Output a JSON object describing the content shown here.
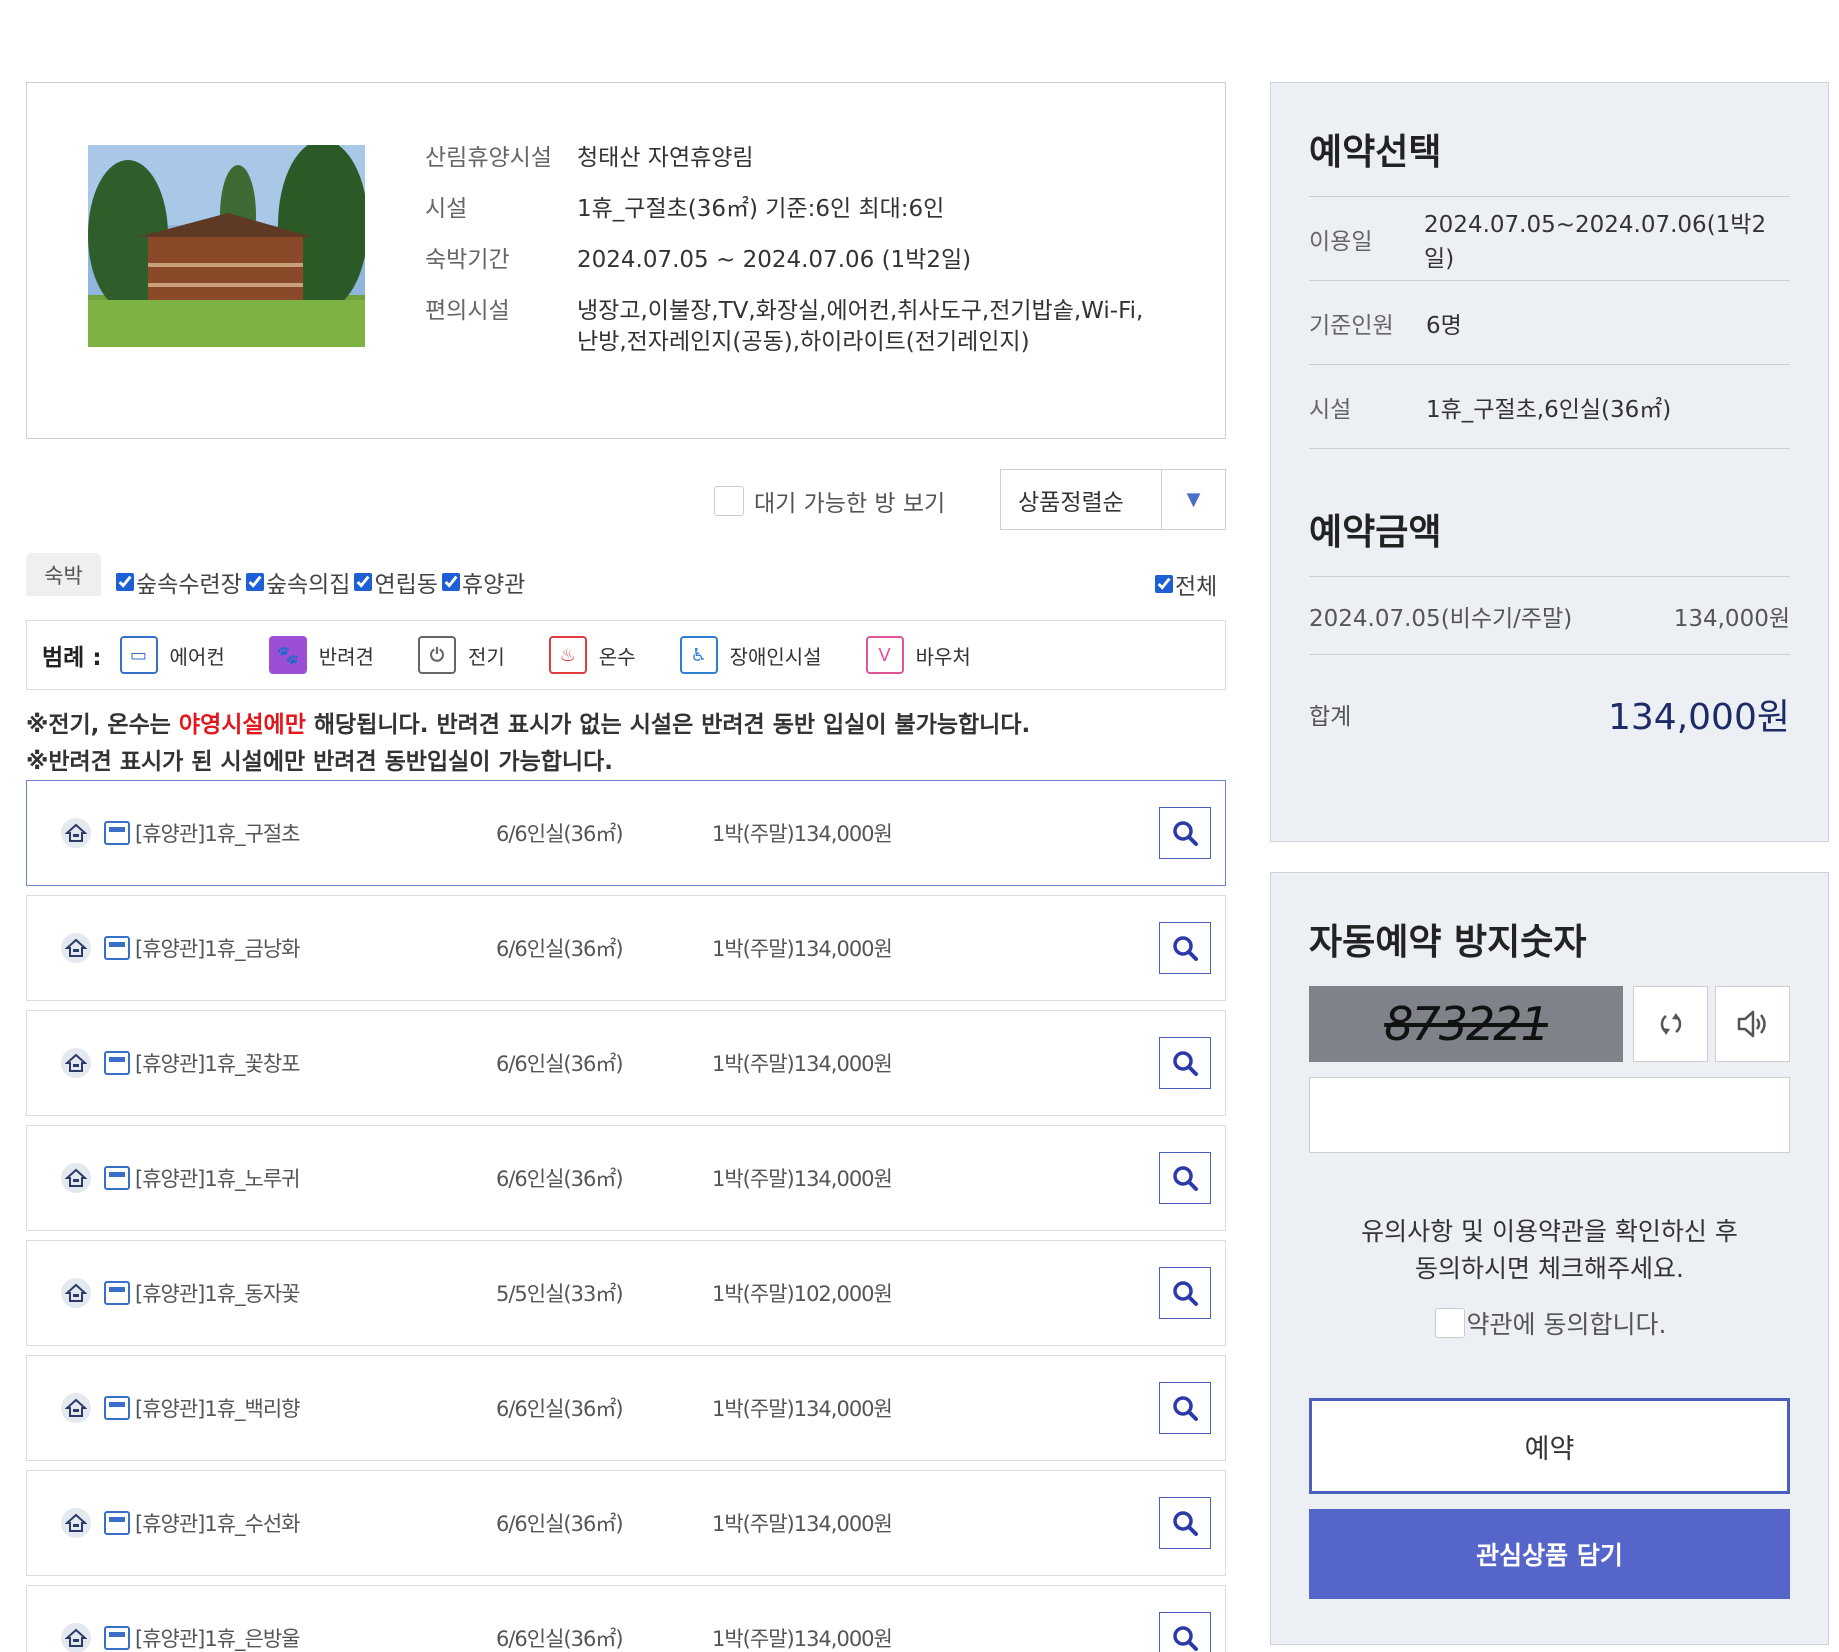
{
  "info": {
    "rows": [
      {
        "label": "산림휴양시설",
        "value": "청태산 자연휴양림"
      },
      {
        "label": "시설",
        "value": "1휴_구절초(36㎡) 기준:6인 최대:6인"
      },
      {
        "label": "숙박기간",
        "value": "2024.07.05 ~ 2024.07.06 (1박2일)"
      },
      {
        "label": "편의시설",
        "value": "냉장고,이불장,TV,화장실,에어컨,취사도구,전기밥솥,Wi-Fi,",
        "value2": "난방,전자레인지(공동),하이라이트(전기레인지)"
      }
    ]
  },
  "filters": {
    "wait_label": "대기 가능한 방 보기",
    "sort_label": "상품정렬순",
    "tab_label": "숙박",
    "types": [
      "숲속수련장",
      "숲속의집",
      "연립동",
      "휴양관"
    ],
    "all_label": "전체"
  },
  "legend": {
    "title": "범례 :",
    "items": [
      {
        "label": "에어컨",
        "icon": "air-conditioner-icon",
        "color": "#3a6fc9"
      },
      {
        "label": "반려견",
        "icon": "dog-icon",
        "color": "#9b4fd6"
      },
      {
        "label": "전기",
        "icon": "plug-icon",
        "color": "#666666"
      },
      {
        "label": "온수",
        "icon": "hot-water-icon",
        "color": "#e23d3d"
      },
      {
        "label": "장애인시설",
        "icon": "wheelchair-icon",
        "color": "#2e7fd1"
      },
      {
        "label": "바우처",
        "icon": "voucher-icon",
        "color": "#e0559a"
      }
    ]
  },
  "notice": {
    "line1_a": "※전기, 온수는 ",
    "line1_red": "야영시설에만",
    "line1_b": " 해당됩니다. 반려견 표시가 없는 시설은 반려견 동반 입실이 불가능합니다.",
    "line2": "※반려견 표시가 된 시설에만 반려견 동반입실이 가능합니다."
  },
  "rooms": [
    {
      "name": "[휴양관]1휴_구절초",
      "capacity": "6/6인실(36㎡)",
      "price": "1박(주말)134,000원"
    },
    {
      "name": "[휴양관]1휴_금낭화",
      "capacity": "6/6인실(36㎡)",
      "price": "1박(주말)134,000원"
    },
    {
      "name": "[휴양관]1휴_꽃창포",
      "capacity": "6/6인실(36㎡)",
      "price": "1박(주말)134,000원"
    },
    {
      "name": "[휴양관]1휴_노루귀",
      "capacity": "6/6인실(36㎡)",
      "price": "1박(주말)134,000원"
    },
    {
      "name": "[휴양관]1휴_동자꽃",
      "capacity": "5/5인실(33㎡)",
      "price": "1박(주말)102,000원"
    },
    {
      "name": "[휴양관]1휴_백리향",
      "capacity": "6/6인실(36㎡)",
      "price": "1박(주말)134,000원"
    },
    {
      "name": "[휴양관]1휴_수선화",
      "capacity": "6/6인실(36㎡)",
      "price": "1박(주말)134,000원"
    },
    {
      "name": "[휴양관]1휴_은방울",
      "capacity": "6/6인실(36㎡)",
      "price": "1박(주말)134,000원"
    }
  ],
  "reservation": {
    "title": "예약선택",
    "rows": [
      {
        "label": "이용일",
        "value": "2024.07.05~2024.07.06(1박2일)"
      },
      {
        "label": "기준인원",
        "value": "6명"
      },
      {
        "label": "시설",
        "value": "1휴_구절초,6인실(36㎡)"
      }
    ],
    "price_title": "예약금액",
    "price_date": "2024.07.05(비수기/주말)",
    "price_amount": "134,000원",
    "total_label": "합계",
    "total_amount": "134,000원"
  },
  "captcha": {
    "title": "자동예약 방지숫자",
    "code": "873221",
    "input_value": "",
    "agree_text_1": "유의사항 및 이용약관을 확인하신 후",
    "agree_text_2": "동의하시면 체크해주세요.",
    "agree_label": "약관에 동의합니다.",
    "reserve_label": "예약",
    "wish_label": "관심상품 담기"
  }
}
